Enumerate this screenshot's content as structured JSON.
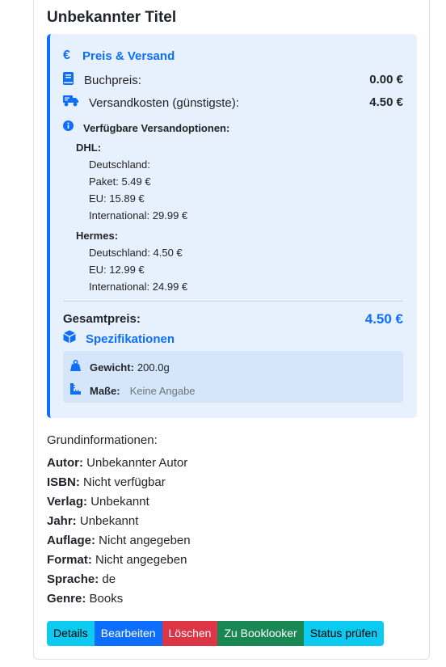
{
  "title": "Unbekannter Titel",
  "price": {
    "heading": "Preis & Versand",
    "book_price_label": "Buchpreis:",
    "book_price_value": "0.00 €",
    "shipping_label": "Versandkosten (günstigste):",
    "shipping_value": "4.50 €",
    "options_heading": "Verfügbare Versandoptionen:",
    "carriers": [
      {
        "name": "DHL:",
        "lines": [
          "Deutschland:",
          "Paket: 5.49 €",
          "EU: 15.89 €",
          "International: 29.99 €"
        ]
      },
      {
        "name": "Hermes:",
        "lines": [
          "Deutschland: 4.50 €",
          "EU: 12.99 €",
          "International: 24.99 €"
        ]
      }
    ],
    "total_label": "Gesamtpreis:",
    "total_value": "4.50 €"
  },
  "specs": {
    "heading": "Spezifikationen",
    "weight_label": "Gewicht:",
    "weight_value": "200.0g",
    "dims_label": "Maße:",
    "dims_value": "Keine Angabe"
  },
  "info": {
    "heading": "Grundinformationen:",
    "rows": [
      {
        "label": "Autor:",
        "value": "Unbekannter Autor"
      },
      {
        "label": "ISBN:",
        "value": "Nicht verfügbar"
      },
      {
        "label": "Verlag:",
        "value": "Unbekannt"
      },
      {
        "label": "Jahr:",
        "value": "Unbekannt"
      },
      {
        "label": "Auflage:",
        "value": "Nicht angegeben"
      },
      {
        "label": "Format:",
        "value": "Nicht angegeben"
      },
      {
        "label": "Sprache:",
        "value": "de"
      },
      {
        "label": "Genre:",
        "value": "Books"
      }
    ]
  },
  "buttons": {
    "details": "Details",
    "edit": "Bearbeiten",
    "delete": "Löschen",
    "booklooker": "Zu Booklooker",
    "status": "Status prüfen"
  },
  "icons": {
    "euro": "euro-icon",
    "book": "book-icon",
    "truck": "truck-icon",
    "info": "info-circle-icon",
    "cube": "cube-icon",
    "weight": "weight-icon",
    "ruler": "ruler-icon"
  },
  "colors": {
    "accent": "#0d6efd",
    "panel_bg": "#e7f1fd",
    "spec_bg": "#d5e6fb",
    "info_btn": "#0dcaf0",
    "danger_btn": "#dc3545",
    "success_btn": "#198754"
  }
}
